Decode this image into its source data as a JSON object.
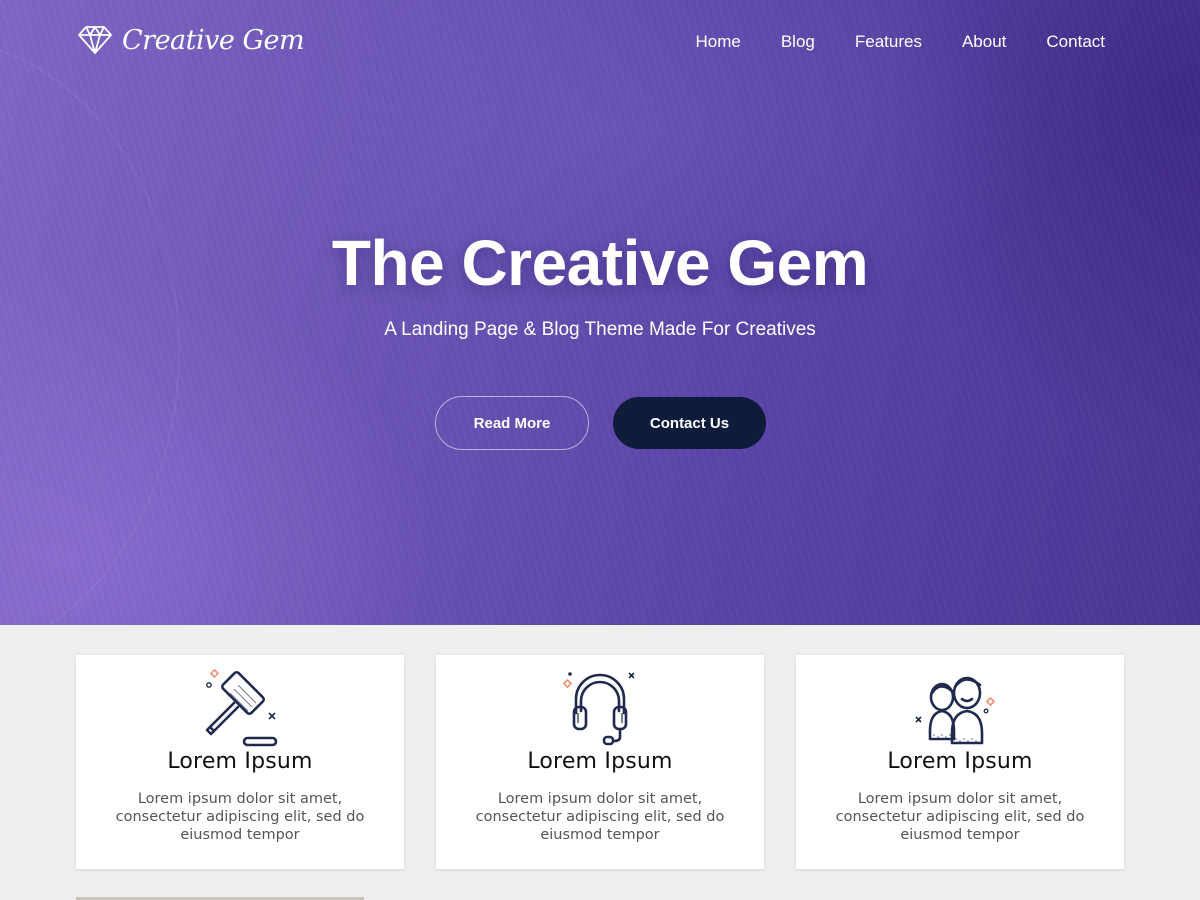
{
  "brand": {
    "logo_text": "Creative Gem",
    "logo_icon": "diamond-icon"
  },
  "nav": {
    "items": [
      {
        "label": "Home"
      },
      {
        "label": "Blog"
      },
      {
        "label": "Features"
      },
      {
        "label": "About"
      },
      {
        "label": "Contact"
      }
    ]
  },
  "hero": {
    "title": "The Creative Gem",
    "subtitle": "A Landing Page & Blog Theme Made For Creatives",
    "read_more_label": "Read More",
    "contact_label": "Contact Us"
  },
  "features": [
    {
      "icon": "gavel-icon",
      "title": "Lorem Ipsum",
      "text": "Lorem ipsum dolor sit amet, consectetur adipiscing elit, sed do eiusmod tempor"
    },
    {
      "icon": "headphones-icon",
      "title": "Lorem Ipsum",
      "text": "Lorem ipsum dolor sit amet, consectetur adipiscing elit, sed do eiusmod tempor"
    },
    {
      "icon": "users-icon",
      "title": "Lorem Ipsum",
      "text": "Lorem ipsum dolor sit amet, consectetur adipiscing elit, sed do eiusmod tempor"
    }
  ],
  "colors": {
    "hero_start": "#7f66c5",
    "hero_end": "#4b3594",
    "contact_button": "#0e1b3a",
    "icon_stroke": "#1f2a4d",
    "icon_accent": "#f08a6e"
  }
}
